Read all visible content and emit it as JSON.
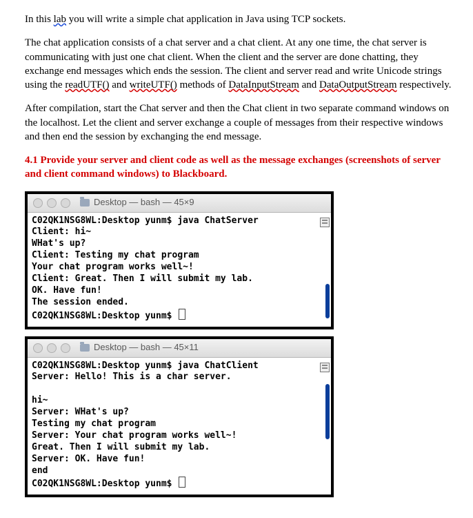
{
  "doc": {
    "para1": {
      "a": "In this ",
      "lab": "lab",
      "b": " you will write a simple chat application in Java using TCP sockets."
    },
    "para2": {
      "a": "The chat application consists of a chat server and a chat client. At any one time, the chat server is communicating with just one chat client. When the client and the server are done chatting, they exchange end messages which ends the session. The client and server read and write Unicode strings using the ",
      "readUTF": "readUTF()",
      "b": " and ",
      "writeUTF": "writeUTF()",
      "c": " methods of ",
      "DIS": "DataInputStream",
      "d": " and ",
      "DOS": "DataOutputStream",
      "e": " respectively."
    },
    "para3": "After compilation, start the Chat server and then the Chat client in two separate command windows on the localhost. Let the client and server exchange a couple of messages from their respective windows and then end the session by exchanging the end message.",
    "requirement": "4.1 Provide your server and client code as well as the message exchanges (screenshots of server and client command windows) to Blackboard."
  },
  "terminal1": {
    "title": "Desktop — bash — 45×9",
    "lines": [
      "C02QK1NSG8WL:Desktop yunm$ java ChatServer",
      "Client: hi~",
      "WHat's up?",
      "Client: Testing my chat program",
      "Your chat program works well~!",
      "Client: Great. Then I will submit my lab.",
      "OK. Have fun!",
      "The session ended."
    ],
    "prompt": "C02QK1NSG8WL:Desktop yunm$ "
  },
  "terminal2": {
    "title": "Desktop — bash — 45×11",
    "lines": [
      "C02QK1NSG8WL:Desktop yunm$ java ChatClient",
      "Server: Hello! This is a char server.",
      "",
      "hi~",
      "Server: WHat's up?",
      "Testing my chat program",
      "Server: Your chat program works well~!",
      "Great. Then I will submit my lab.",
      "Server: OK. Have fun!",
      "end"
    ],
    "prompt": "C02QK1NSG8WL:Desktop yunm$ "
  }
}
